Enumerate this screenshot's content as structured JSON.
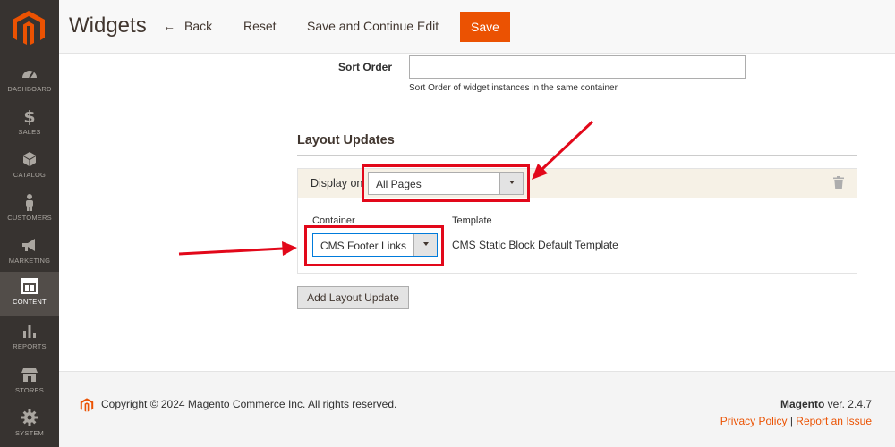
{
  "header": {
    "title": "Widgets",
    "back_label": "Back",
    "reset_label": "Reset",
    "save_continue_label": "Save and Continue Edit",
    "save_label": "Save"
  },
  "sidebar": {
    "items": [
      {
        "label": "DASHBOARD",
        "icon": "dashboard-icon"
      },
      {
        "label": "SALES",
        "icon": "dollar-icon"
      },
      {
        "label": "CATALOG",
        "icon": "cube-icon"
      },
      {
        "label": "CUSTOMERS",
        "icon": "person-icon"
      },
      {
        "label": "MARKETING",
        "icon": "megaphone-icon"
      },
      {
        "label": "CONTENT",
        "icon": "layout-icon",
        "active": true
      },
      {
        "label": "REPORTS",
        "icon": "bar-chart-icon"
      },
      {
        "label": "STORES",
        "icon": "storefront-icon"
      },
      {
        "label": "SYSTEM",
        "icon": "gear-icon"
      }
    ]
  },
  "form": {
    "sort_order_label": "Sort Order",
    "sort_order_value": "",
    "sort_order_note": "Sort Order of widget instances in the same container"
  },
  "layout_updates": {
    "heading": "Layout Updates",
    "display_on_label": "Display on",
    "display_on_value": "All Pages",
    "container_label": "Container",
    "container_value": "CMS Footer Links",
    "template_label": "Template",
    "template_value": "CMS Static Block Default Template",
    "add_button_label": "Add Layout Update"
  },
  "footer": {
    "copyright": "Copyright © 2024 Magento Commerce Inc. All rights reserved.",
    "brand": "Magento",
    "version": " ver. 2.4.7",
    "privacy_link": "Privacy Policy",
    "separator": "|",
    "report_link": "Report an Issue"
  },
  "colors": {
    "sidebar_bg": "#373330",
    "accent": "#eb5202",
    "annotation_red": "#e2081a"
  }
}
